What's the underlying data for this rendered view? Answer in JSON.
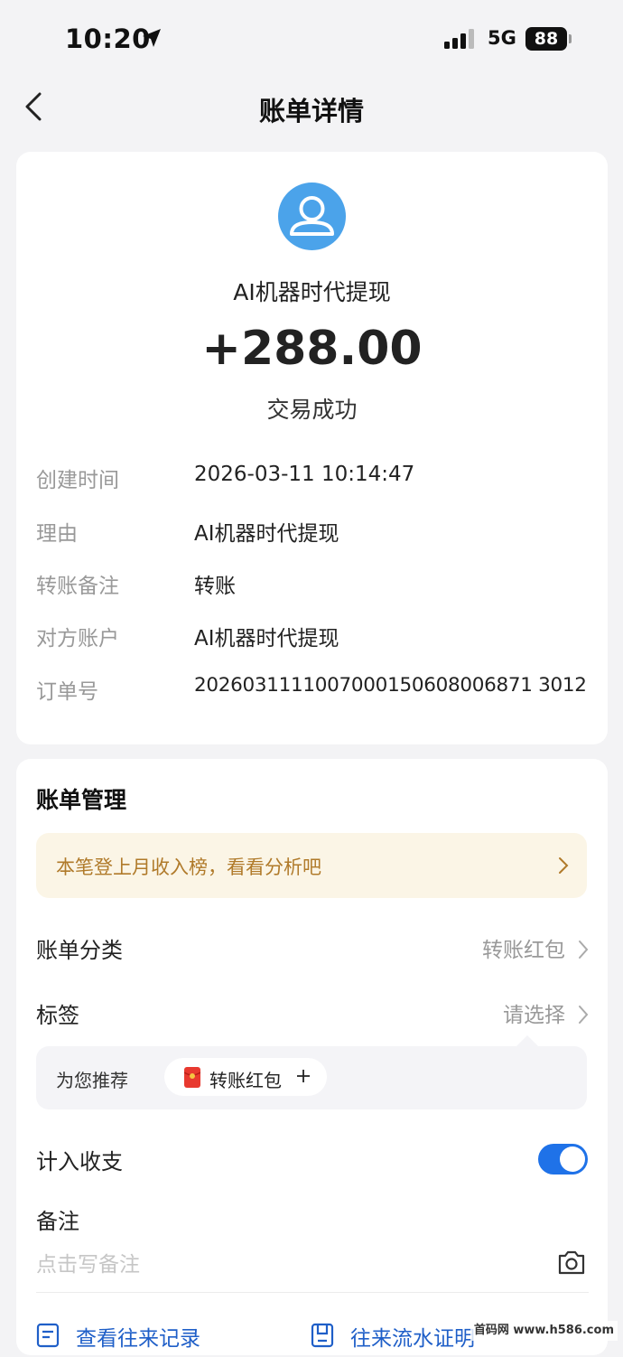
{
  "status_bar": {
    "time": "10:20",
    "network": "5G",
    "battery": "88"
  },
  "nav": {
    "title": "账单详情"
  },
  "detail": {
    "counterparty": "AI机器时代提现",
    "amount": "+288.00",
    "status": "交易成功",
    "rows": [
      {
        "label": "创建时间",
        "value": "2026-03-11 10:14:47"
      },
      {
        "label": "理由",
        "value": "AI机器时代提现"
      },
      {
        "label": "转账备注",
        "value": "转账"
      },
      {
        "label": "对方账户",
        "value": "AI机器时代提现"
      },
      {
        "label": "订单号",
        "value": "2026031111007000150608006871 3012"
      }
    ]
  },
  "manage": {
    "title": "账单管理",
    "banner_text": "本笔登上月收入榜，看看分析吧",
    "category": {
      "label": "账单分类",
      "value": "转账红包"
    },
    "tag": {
      "label": "标签",
      "value": "请选择"
    },
    "recommend": {
      "label": "为您推荐",
      "chip": "转账红包"
    },
    "include": {
      "label": "计入收支",
      "enabled": true
    },
    "note": {
      "label": "备注",
      "placeholder": "点击写备注"
    },
    "actions": {
      "history": "查看往来记录",
      "proof": "往来流水证明"
    }
  },
  "watermark": "首码网 www.h586.com",
  "colors": {
    "accent": "#1f72e8",
    "avatar": "#4ba3ea",
    "banner_bg": "#fbf5e6",
    "banner_text": "#b07a2a"
  }
}
